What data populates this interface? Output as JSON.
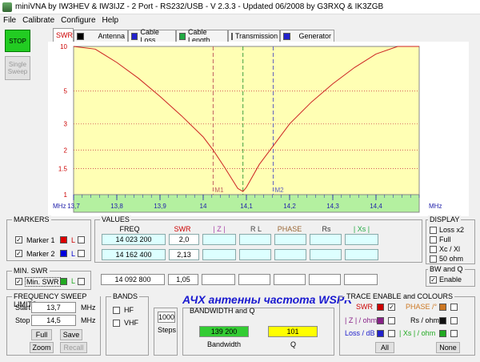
{
  "window": {
    "title": "miniVNA by IW3HEV & IW3IJZ - 2 Port - RS232/USB - V 2.3.3 - Updated 06/2008 by G3RXQ & IK3ZGB"
  },
  "menu": [
    "File",
    "Calibrate",
    "Configure",
    "Help"
  ],
  "buttons": {
    "stop": "STOP",
    "single_line1": "Single",
    "single_line2": "Sweep"
  },
  "tabs": [
    {
      "label": "SWR",
      "color": ""
    },
    {
      "label": "Antenna",
      "color": "#000000"
    },
    {
      "label": "Cable Loss",
      "color": "#2222cc"
    },
    {
      "label": "Cable Length",
      "color": "#22aa44"
    },
    {
      "label": "Transmission",
      "color": "#2222cc"
    },
    {
      "label": "Generator",
      "color": "#2222cc"
    }
  ],
  "chart_data": {
    "type": "line",
    "xlabel": "MHz",
    "ylabel": "SWR",
    "x_ticks": [
      "13,7",
      "13,8",
      "13,9",
      "14",
      "14,1",
      "14,2",
      "14,3",
      "14,4"
    ],
    "y_ticks": [
      "10",
      "5",
      "3",
      "2",
      "1.5",
      "1"
    ],
    "xlim": [
      13.7,
      14.5
    ],
    "ylim": [
      1,
      10
    ],
    "y_scale": "log",
    "series": [
      {
        "values_x": [
          13.7,
          13.75,
          13.8,
          13.85,
          13.9,
          13.95,
          14.0,
          14.023,
          14.05,
          14.08,
          14.092,
          14.1,
          14.13,
          14.162,
          14.2,
          14.25,
          14.3,
          14.35,
          14.4,
          14.45,
          14.5
        ],
        "values_y": [
          10.5,
          9.6,
          7.8,
          6.1,
          4.6,
          3.4,
          2.45,
          2.0,
          1.52,
          1.1,
          1.05,
          1.12,
          1.6,
          2.13,
          3.0,
          4.2,
          5.6,
          7.2,
          8.9,
          10.4,
          12.0
        ]
      }
    ],
    "markers": [
      {
        "label": "M1",
        "x": 14.023,
        "color": "#c06060"
      },
      {
        "label": "M2",
        "x": 14.162,
        "color": "#6060c0"
      }
    ],
    "center_marker": {
      "x": 14.092,
      "color": "#40a040"
    },
    "grid": true
  },
  "markers": {
    "title": "MARKERS",
    "m1": {
      "label": "Marker 1",
      "color": "#dd0000",
      "l": "L"
    },
    "m2": {
      "label": "Marker 2",
      "color": "#0000dd",
      "l": "L"
    }
  },
  "values": {
    "title": "VALUES",
    "headers": [
      "FREQ",
      "SWR",
      "| Z |",
      "R L",
      "PHASE",
      "Rs",
      "| Xs |"
    ],
    "header_colors": [
      "#000000",
      "#cc0000",
      "#aa44aa",
      "#444444",
      "#996633",
      "#333333",
      "#22aa44"
    ],
    "row1": {
      "freq": "14 023 200",
      "swr": "2,0"
    },
    "row2": {
      "freq": "14 162 400",
      "swr": "2,13"
    },
    "row3": {
      "freq": "14 092 800",
      "swr": "1,05"
    }
  },
  "minswr": {
    "title": "MIN. SWR",
    "label": "Min. SWR",
    "color": "#22aa22",
    "l": "L"
  },
  "display": {
    "title": "DISPLAY",
    "items": [
      "Loss x2",
      "Full",
      "Xc / Xl",
      "50 ohm"
    ]
  },
  "bwq": {
    "title": "BW and Q",
    "label": "Enable"
  },
  "sweep": {
    "title": "FREQUENCY SWEEP LIMITS",
    "start_label": "Start",
    "start": "13,7",
    "stop_label": "Stop",
    "stop": "14,5",
    "unit": "MHz",
    "full": "Full",
    "save": "Save",
    "zoom": "Zoom",
    "recall": "Recall"
  },
  "bands": {
    "title": "BANDS",
    "hf": "HF",
    "vhf": "VHF"
  },
  "steps": {
    "value": "1000",
    "label": "Steps"
  },
  "overlay_title": "АЧХ антенны частота WSPR",
  "bandwidth": {
    "title": "BANDWIDTH and Q",
    "bw_value": "139 200",
    "bw_label": "Bandwidth",
    "q_value": "101",
    "q_label": "Q"
  },
  "trace": {
    "title": "TRACE ENABLE and COLOURS",
    "items": [
      {
        "label": "SWR",
        "color": "#cc0000",
        "text_color": "#cc0000",
        "checked": true
      },
      {
        "label": "PHASE /°",
        "color": "#cc7722",
        "text_color": "#cc7722",
        "checked": false
      },
      {
        "label": "| Z | / ohm",
        "color": "#882288",
        "text_color": "#882288",
        "checked": false
      },
      {
        "label": "Rs / ohm",
        "color": "#111111",
        "text_color": "#111111",
        "checked": false
      },
      {
        "label": "Loss / dB",
        "color": "#2222cc",
        "text_color": "#2222cc",
        "checked": false
      },
      {
        "label": "| Xs | / ohm",
        "color": "#22aa22",
        "text_color": "#22aa22",
        "checked": false
      }
    ],
    "all": "All",
    "none": "None"
  }
}
